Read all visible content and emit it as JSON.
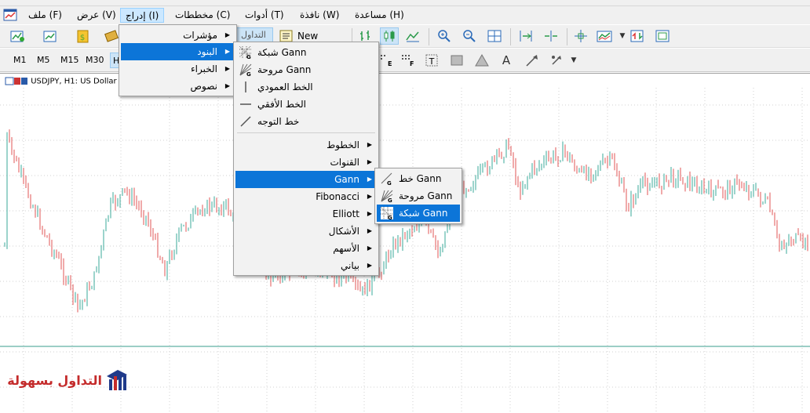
{
  "menubar": {
    "items": [
      "ملف (F)",
      "عرض (V)",
      "إدراج (I)",
      "مخططات (C)",
      "أدوات (T)",
      "نافذة (W)",
      "مساعدة (H)"
    ]
  },
  "toolbar": {
    "new_order_label": "New Order",
    "trading_partial": "التداول",
    "timeframes": [
      "M1",
      "M5",
      "M15",
      "M30",
      "H"
    ],
    "text_tool": "A"
  },
  "chart": {
    "title": "USDJPY, H1:  US Dollar"
  },
  "insert_menu": {
    "items": [
      {
        "label": "مؤشرات",
        "submenu": true
      },
      {
        "label": "البنود",
        "submenu": true,
        "highlighted": true
      },
      {
        "label": "الخبراء",
        "submenu": true
      },
      {
        "label": "نصوص",
        "submenu": true
      }
    ]
  },
  "objects_menu": {
    "items": [
      {
        "label": "شبكة Gann",
        "icon": "gann-grid-icon"
      },
      {
        "label": "مروحة Gann",
        "icon": "gann-fan-icon"
      },
      {
        "label": "الخط العمودي",
        "icon": "vertical-line-icon"
      },
      {
        "label": "الخط الأفقي",
        "icon": "horizontal-line-icon"
      },
      {
        "label": "خط التوجه",
        "icon": "trendline-icon"
      }
    ],
    "groups": [
      {
        "label": "الخطوط"
      },
      {
        "label": "القنوات"
      },
      {
        "label": "Gann",
        "highlighted": true
      },
      {
        "label": "Fibonacci"
      },
      {
        "label": "Elliott"
      },
      {
        "label": "الأشكال"
      },
      {
        "label": "الأسهم"
      },
      {
        "label": "بياني"
      }
    ]
  },
  "gann_menu": {
    "items": [
      {
        "label": "خط Gann",
        "icon": "gann-line-icon"
      },
      {
        "label": "مروحة Gann",
        "icon": "gann-fan-icon"
      },
      {
        "label": "شبكة Gann",
        "icon": "gann-grid-icon",
        "highlighted": true
      }
    ]
  },
  "watermark": {
    "text": "التداول بسهولة"
  },
  "colors": {
    "highlight": "#0c75d8",
    "bull_candle": "#3aa89a",
    "bear_candle": "#e05555",
    "hline": "#3a9e8e"
  }
}
